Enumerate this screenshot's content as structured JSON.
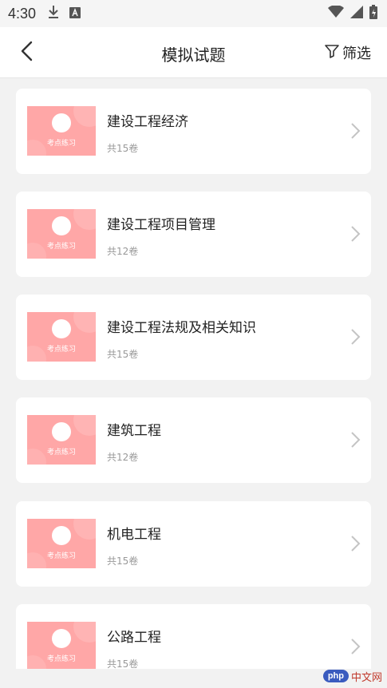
{
  "status_bar": {
    "time": "4:30",
    "left_icons": [
      "download-icon",
      "text-a-icon"
    ],
    "right_icons": [
      "wifi-icon",
      "signal-icon",
      "battery-charging-icon"
    ]
  },
  "app_bar": {
    "title": "模拟试题",
    "filter_label": "筛选"
  },
  "thumb_label": "考点练习",
  "items": [
    {
      "title": "建设工程经济",
      "count": "共15卷"
    },
    {
      "title": "建设工程项目管理",
      "count": "共12卷"
    },
    {
      "title": "建设工程法规及相关知识",
      "count": "共15卷"
    },
    {
      "title": "建筑工程",
      "count": "共12卷"
    },
    {
      "title": "机电工程",
      "count": "共15卷"
    },
    {
      "title": "公路工程",
      "count": "共15卷"
    }
  ],
  "watermark": {
    "logo": "php",
    "text": "中文网"
  },
  "colors": {
    "thumb_bg": "#ffa7a7",
    "page_bg": "#f2f2f2",
    "card_bg": "#ffffff"
  }
}
